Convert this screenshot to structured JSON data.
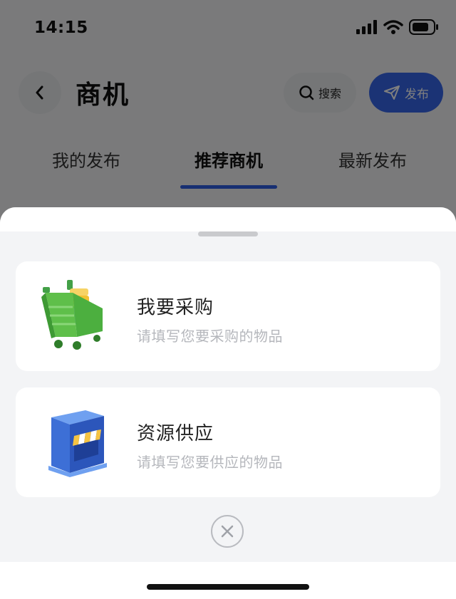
{
  "status_bar": {
    "time": "14:15"
  },
  "header": {
    "title": "商机",
    "search_label": "搜索",
    "publish_label": "发布"
  },
  "tabs": [
    {
      "label": "我的发布"
    },
    {
      "label": "推荐商机"
    },
    {
      "label": "最新发布"
    }
  ],
  "active_tab": "推荐商机",
  "sheet": {
    "options": [
      {
        "title": "我要采购",
        "subtitle": "请填写您要采购的物品",
        "icon": "shopping-cart-icon"
      },
      {
        "title": "资源供应",
        "subtitle": "请填写您要供应的物品",
        "icon": "storefront-icon"
      }
    ],
    "close_icon": "close-icon"
  },
  "colors": {
    "accent": "#3766ea",
    "sheet_background": "#f3f4f6",
    "subtitle_gray": "#b5b7bc"
  }
}
